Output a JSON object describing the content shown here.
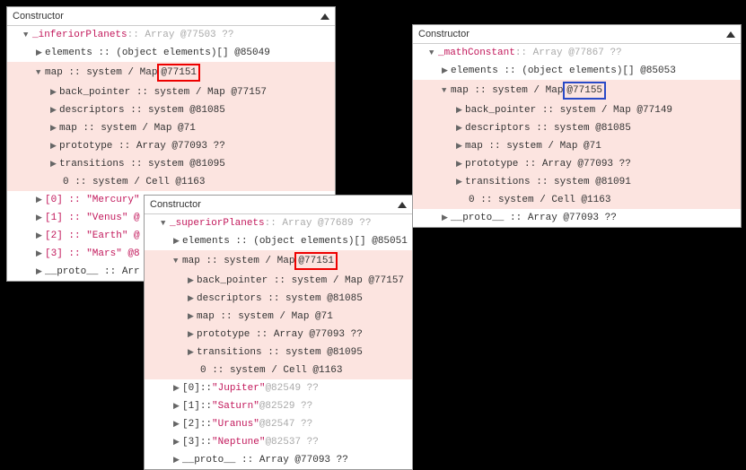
{
  "panels": {
    "p1": {
      "title": "Constructor",
      "root_name": "_inferiorPlanets",
      "root_suffix": " :: Array @77503 ??",
      "el_items": "elements :: (object elements)[] @85049",
      "map_prefix": "map :: system / Map ",
      "map_id": "@77151",
      "map_children": {
        "back_pointer": "back_pointer :: system / Map @77157",
        "descriptors": "descriptors :: system @81085",
        "map_inner": "map :: system / Map @71",
        "prototype": "prototype :: Array @77093 ??",
        "transitions": "transitions :: system @81095",
        "cell": "0 :: system / Cell @1163"
      },
      "items": [
        "[0] :: \"Mercury\"",
        "[1] :: \"Venus\" @",
        "[2] :: \"Earth\" @",
        "[3] :: \"Mars\" @8"
      ],
      "proto": "__proto__ :: Arr"
    },
    "p2": {
      "title": "Constructor",
      "root_name": "_superiorPlanets",
      "root_suffix": " :: Array @77689 ??",
      "el_items": "elements :: (object elements)[] @85051",
      "map_prefix": "map :: system / Map ",
      "map_id": "@77151",
      "map_children": {
        "back_pointer": "back_pointer :: system / Map @77157",
        "descriptors": "descriptors :: system @81085",
        "map_inner": "map :: system / Map @71",
        "prototype": "prototype :: Array @77093 ??",
        "transitions": "transitions :: system @81095",
        "cell": "0 :: system / Cell @1163"
      },
      "items0": {
        "idx": "[0]",
        "sep": " :: ",
        "val": "\"Jupiter\"",
        "tail": " @82549 ??"
      },
      "items1": {
        "idx": "[1]",
        "sep": " :: ",
        "val": "\"Saturn\"",
        "tail": " @82529 ??"
      },
      "items2": {
        "idx": "[2]",
        "sep": " :: ",
        "val": "\"Uranus\"",
        "tail": " @82547 ??"
      },
      "items3": {
        "idx": "[3]",
        "sep": " :: ",
        "val": "\"Neptune\"",
        "tail": " @82537 ??"
      },
      "proto": "__proto__ :: Array @77093 ??"
    },
    "p3": {
      "title": "Constructor",
      "root_name": "_mathConstant",
      "root_suffix": " :: Array @77867 ??",
      "el_items": "elements :: (object elements)[] @85053",
      "map_prefix": "map :: system / Map ",
      "map_id": "@77155",
      "map_children": {
        "back_pointer": "back_pointer :: system / Map @77149",
        "descriptors": "descriptors :: system @81085",
        "map_inner": "map :: system / Map @71",
        "prototype": "prototype :: Array @77093 ??",
        "transitions": "transitions :: system @81091",
        "cell": "0 :: system / Cell @1163"
      },
      "proto": "__proto__ :: Array @77093 ??"
    }
  }
}
